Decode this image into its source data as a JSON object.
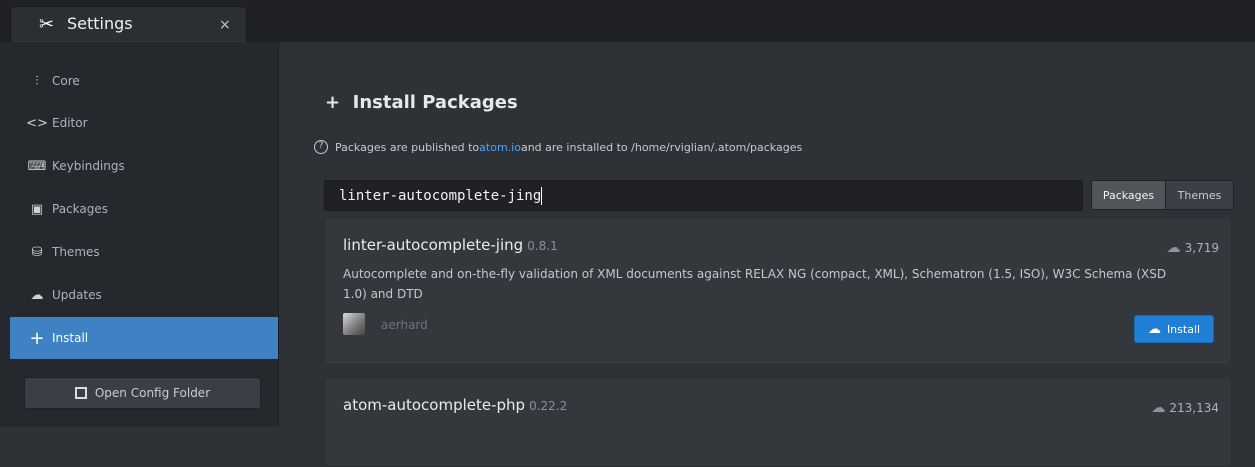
{
  "tab": {
    "title": "Settings",
    "close": "×"
  },
  "sidebar": {
    "items": [
      {
        "label": "Core",
        "icon": "sliders-icon"
      },
      {
        "label": "Editor",
        "icon": "code-icon"
      },
      {
        "label": "Keybindings",
        "icon": "keyboard-icon"
      },
      {
        "label": "Packages",
        "icon": "package-icon"
      },
      {
        "label": "Themes",
        "icon": "paintcan-icon"
      },
      {
        "label": "Updates",
        "icon": "cloud-download-icon"
      },
      {
        "label": "Install",
        "icon": "plus-icon",
        "active": true
      }
    ],
    "config_button": "Open Config Folder"
  },
  "main": {
    "title": "Install Packages",
    "info_prefix": "Packages are published to ",
    "info_link": "atom.io",
    "info_suffix": " and are installed to /home/rviglian/.atom/packages",
    "search_value": "linter-autocomplete-jing",
    "toggle": {
      "packages": "Packages",
      "themes": "Themes"
    },
    "packages": [
      {
        "name": "linter-autocomplete-jing",
        "version": "0.8.1",
        "downloads": "3,719",
        "description": "Autocomplete and on-the-fly validation of XML documents against RELAX NG (compact, XML), Schematron (1.5, ISO), W3C Schema (XSD 1.0) and DTD",
        "author": "aerhard",
        "install_label": "Install"
      },
      {
        "name": "atom-autocomplete-php",
        "version": "0.22.2",
        "downloads": "213,134"
      }
    ]
  },
  "colors": {
    "accent": "#3f82c4",
    "install": "#1f7fd6",
    "link": "#4aa3ff"
  }
}
